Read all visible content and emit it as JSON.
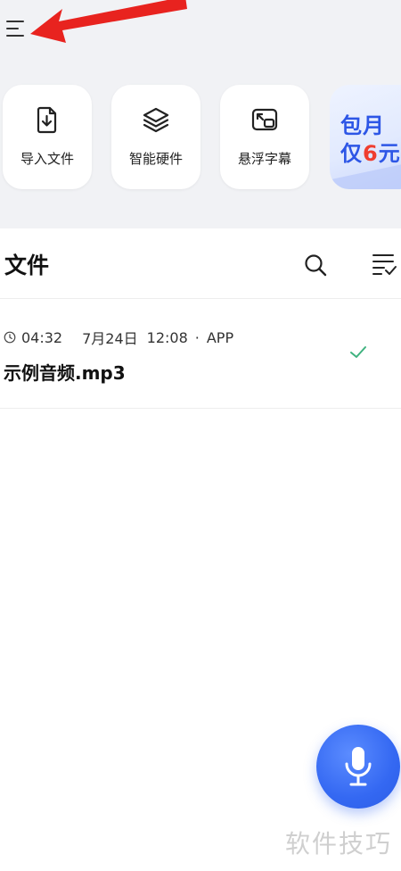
{
  "quick_actions": [
    {
      "label": "导入文件",
      "icon": "import-file-icon"
    },
    {
      "label": "智能硬件",
      "icon": "layers-icon"
    },
    {
      "label": "悬浮字幕",
      "icon": "floating-window-icon"
    }
  ],
  "promo": {
    "line1": "包月",
    "line2_prefix": "仅",
    "line2_number": "6",
    "line2_suffix": "元"
  },
  "files": {
    "title": "文件",
    "items": [
      {
        "duration": "04:32",
        "date": "7月24日",
        "time": "12:08",
        "separator": "·",
        "source": "APP",
        "name": "示例音频.mp3",
        "status": "check-icon"
      }
    ]
  },
  "watermark": "软件技巧",
  "colors": {
    "accent": "#3468f2",
    "promo_red": "#ef3d2f",
    "arrow_red": "#e8231f",
    "check_green": "#3fb27f"
  }
}
